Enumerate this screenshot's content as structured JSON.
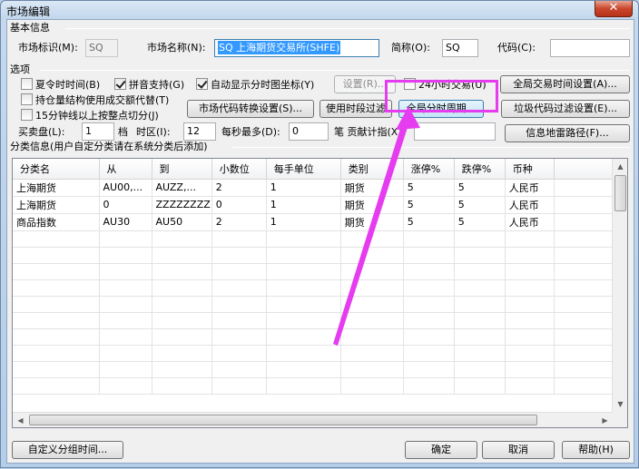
{
  "window": {
    "title": "市场编辑",
    "close_glyph": "✕"
  },
  "basic_info": {
    "group_title": "基本信息",
    "market_id_label": "市场标识(M):",
    "market_id_value": "SQ",
    "market_name_label": "市场名称(N):",
    "market_name_value": "SQ 上海期货交易所(SHFE)",
    "short_name_label": "简称(O):",
    "short_name_value": "SQ",
    "code_label": "代码(C):",
    "code_value": ""
  },
  "options": {
    "group_title": "选项",
    "checkboxes": {
      "summer_time": {
        "label": "夏令时时间(B)",
        "checked": false
      },
      "pinyin": {
        "label": "拼音支持(G)",
        "checked": true
      },
      "auto_minute": {
        "label": "自动显示分时图坐标(Y)",
        "checked": true
      },
      "hours24": {
        "label": "24小时交易(U)",
        "checked": false
      },
      "open_interest": {
        "label": "持仓量结构使用成交额代替(T)",
        "checked": false
      },
      "min15": {
        "label": "15分钟线以上按整点切分(J)",
        "checked": false
      }
    },
    "settings_button": "设置(R)...",
    "global_trade_time_button": "全局交易时间设置(A)...",
    "market_code_convert_button": "市场代码转换设置(S)...",
    "use_period_filter_button": "使用时段过滤",
    "global_minute_period_button": "全局分时周期...",
    "junk_code_filter_button": "垃圾代码过滤设置(E)...",
    "info_mine_path_button": "信息地雷路径(F)...",
    "buy_sell_label": "买卖盘(L):",
    "buy_sell_value": "1",
    "level_label": "档",
    "timezone_label": "时区(I):",
    "timezone_value": "12",
    "max_per_sec_label": "每秒最多(D):",
    "max_per_sec_value": "0",
    "contribution_label": "笔  贡献计指(X)"
  },
  "category": {
    "group_title": "分类信息(用户自定分类请在系统分类后添加)",
    "columns": [
      "分类名",
      "从",
      "到",
      "小数位",
      "每手单位",
      "类别",
      "涨停%",
      "跌停%",
      "币种"
    ],
    "rows": [
      [
        "上海期货",
        "AU00,...",
        "AUZZ,...",
        "2",
        "1",
        "期货",
        "5",
        "5",
        "人民币"
      ],
      [
        "上海期货",
        "0",
        "ZZZZZZZZ",
        "0",
        "1",
        "期货",
        "5",
        "5",
        "人民币"
      ],
      [
        "商品指数",
        "AU30",
        "AU50",
        "2",
        "1",
        "期货",
        "5",
        "5",
        "人民币"
      ]
    ]
  },
  "footer": {
    "custom_group_time_button": "自定义分组时间...",
    "ok_button": "确定",
    "cancel_button": "取消",
    "help_button": "帮助(H)"
  },
  "annotation_color": "#e63cf0"
}
